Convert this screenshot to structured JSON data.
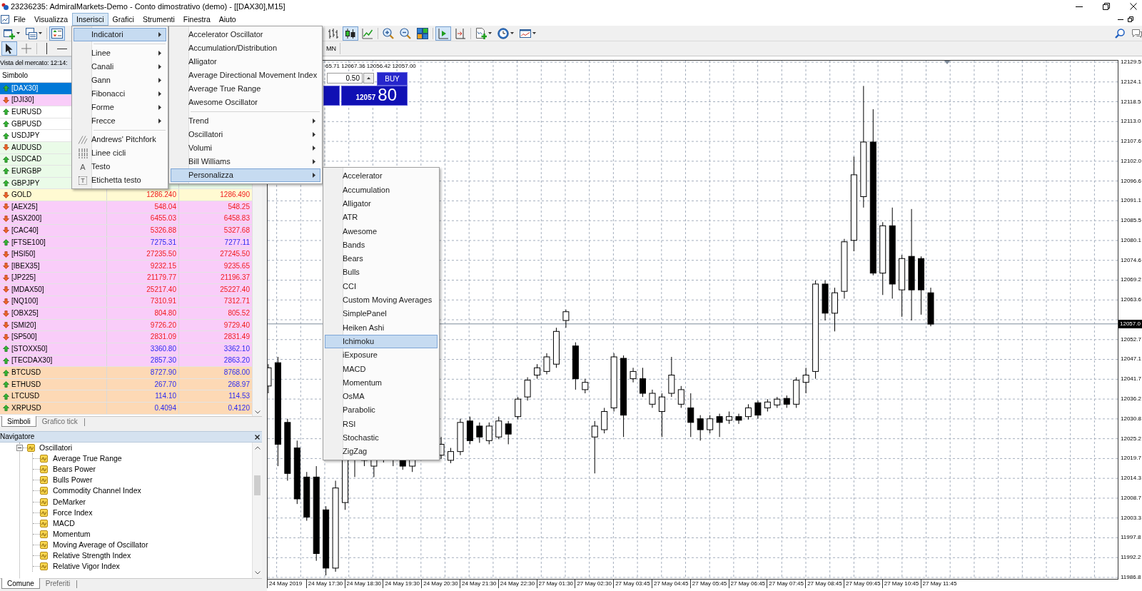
{
  "window": {
    "title": "23236235: AdmiralMarkets-Demo - Conto dimostrativo (demo) - [[DAX30],M15]"
  },
  "menu_bar": [
    {
      "label": "File",
      "selected": false
    },
    {
      "label": "Visualizza",
      "selected": false
    },
    {
      "label": "Inserisci",
      "selected": true
    },
    {
      "label": "Grafici",
      "selected": false
    },
    {
      "label": "Strumenti",
      "selected": false
    },
    {
      "label": "Finestra",
      "selected": false
    },
    {
      "label": "Aiuto",
      "selected": false
    }
  ],
  "toolbar_1": {
    "left_groups": [
      [
        {
          "kind": "new-chart",
          "pressed": false
        },
        {
          "kind": "profiles",
          "pressed": false
        }
      ],
      [
        {
          "kind": "market-watch",
          "pressed": true
        }
      ]
    ],
    "right_groups": [
      [
        {
          "kind": "bar-chart",
          "pressed": false
        },
        {
          "kind": "candlesticks",
          "pressed": true
        },
        {
          "kind": "line-chart",
          "pressed": false
        }
      ],
      [
        {
          "kind": "zoom-in",
          "pressed": false
        },
        {
          "kind": "zoom-out",
          "pressed": false
        },
        {
          "kind": "tile",
          "pressed": false
        }
      ],
      [
        {
          "kind": "auto-scroll",
          "pressed": true
        },
        {
          "kind": "chart-shift",
          "pressed": false
        }
      ],
      [
        {
          "kind": "indicators",
          "pressed": false
        },
        {
          "kind": "periods",
          "pressed": false
        },
        {
          "kind": "templates",
          "pressed": false
        }
      ]
    ]
  },
  "toolbar_2": {
    "left_groups": [
      [
        {
          "kind": "cursor",
          "pressed": true
        },
        {
          "kind": "crosshair",
          "pressed": false
        }
      ],
      [
        {
          "kind": "vertical-line",
          "pressed": false
        },
        {
          "kind": "horizontal-line",
          "pressed": false
        }
      ]
    ],
    "timeframes": [
      {
        "label": "MN",
        "selected": false
      }
    ]
  },
  "insert_menu": {
    "groups": [
      [
        {
          "label": "Indicatori",
          "submenu": true,
          "selected": true
        }
      ],
      [
        {
          "label": "Linee",
          "submenu": true,
          "selected": false
        },
        {
          "label": "Canali",
          "submenu": true,
          "selected": false
        },
        {
          "label": "Gann",
          "submenu": true,
          "selected": false
        },
        {
          "label": "Fibonacci",
          "submenu": true,
          "selected": false
        },
        {
          "label": "Forme",
          "submenu": true,
          "selected": false
        },
        {
          "label": "Frecce",
          "submenu": true,
          "selected": false
        }
      ],
      [
        {
          "label": "Andrews' Pitchfork",
          "kind": "pitchfork",
          "submenu": false,
          "selected": false
        },
        {
          "label": "Linee cicli",
          "kind": "cycle-lines",
          "submenu": false,
          "selected": false
        },
        {
          "label": "Testo",
          "kind": "glyph",
          "glyph": "A",
          "submenu": false,
          "selected": false
        },
        {
          "label": "Etichetta testo",
          "kind": "boxed-glyph",
          "glyph": "T",
          "submenu": false,
          "selected": false
        }
      ]
    ]
  },
  "indicators_menu": {
    "groups": [
      [
        {
          "label": "Accelerator Oscillator",
          "submenu": false,
          "selected": false
        },
        {
          "label": "Accumulation/Distribution",
          "submenu": false,
          "selected": false
        },
        {
          "label": "Alligator",
          "submenu": false,
          "selected": false
        },
        {
          "label": "Average Directional Movement Index",
          "submenu": false,
          "selected": false
        },
        {
          "label": "Average True Range",
          "submenu": false,
          "selected": false
        },
        {
          "label": "Awesome Oscillator",
          "submenu": false,
          "selected": false
        }
      ],
      [
        {
          "label": "Trend",
          "submenu": true,
          "selected": false
        },
        {
          "label": "Oscillatori",
          "submenu": true,
          "selected": false
        },
        {
          "label": "Volumi",
          "submenu": true,
          "selected": false
        },
        {
          "label": "Bill Williams",
          "submenu": true,
          "selected": false
        },
        {
          "label": "Personalizza",
          "submenu": true,
          "selected": true
        }
      ]
    ]
  },
  "custom_menu": {
    "groups": [
      [
        {
          "label": "Accelerator",
          "selected": false
        },
        {
          "label": "Accumulation",
          "selected": false
        },
        {
          "label": "Alligator",
          "selected": false
        },
        {
          "label": "ATR",
          "selected": false
        },
        {
          "label": "Awesome",
          "selected": false
        },
        {
          "label": "Bands",
          "selected": false
        },
        {
          "label": "Bears",
          "selected": false
        },
        {
          "label": "Bulls",
          "selected": false
        },
        {
          "label": "CCI",
          "selected": false
        },
        {
          "label": "Custom Moving Averages",
          "selected": false
        },
        {
          "label": "SimplePanel",
          "selected": false
        },
        {
          "label": "Heiken Ashi",
          "selected": false
        },
        {
          "label": "Ichimoku",
          "selected": true
        },
        {
          "label": "iExposure",
          "selected": false
        },
        {
          "label": "MACD",
          "selected": false
        },
        {
          "label": "Momentum",
          "selected": false
        },
        {
          "label": "OsMA",
          "selected": false
        },
        {
          "label": "Parabolic",
          "selected": false
        },
        {
          "label": "RSI",
          "selected": false
        },
        {
          "label": "Stochastic",
          "selected": false
        },
        {
          "label": "ZigZag",
          "selected": false
        }
      ]
    ]
  },
  "market_watch": {
    "title": "Vista del mercato: 12:14:",
    "column_header": "Simbolo",
    "rows": [
      {
        "symbol": "[DAX30]",
        "rising": true,
        "selected": true
      },
      {
        "symbol": "[DJI30]",
        "rising": false,
        "selected": false,
        "color": "#f9cdf9"
      },
      {
        "symbol": "EURUSD",
        "rising": true,
        "selected": false,
        "color": "#ffffff"
      },
      {
        "symbol": "GBPUSD",
        "rising": true,
        "selected": false,
        "color": "#ffffff"
      },
      {
        "symbol": "USDJPY",
        "rising": true,
        "selected": false,
        "color": "#ffffff"
      },
      {
        "symbol": "AUDUSD",
        "rising": false,
        "selected": false,
        "color": "#eafbe8"
      },
      {
        "symbol": "USDCAD",
        "rising": true,
        "selected": false,
        "color": "#eafbe8"
      },
      {
        "symbol": "EURGBP",
        "rising": true,
        "selected": false,
        "color": "#eafbe8"
      },
      {
        "symbol": "GBPJPY",
        "rising": true,
        "selected": false,
        "color": "#eafbe8"
      },
      {
        "symbol": "GOLD",
        "rising": false,
        "selected": false,
        "color": "#fffad2",
        "bid": "1286.240",
        "ask": "1286.490"
      },
      {
        "symbol": "[AEX25]",
        "rising": false,
        "selected": false,
        "color": "#f9cdf9",
        "bid": "548.04",
        "ask": "548.25"
      },
      {
        "symbol": "[ASX200]",
        "rising": false,
        "selected": false,
        "color": "#f9cdf9",
        "bid": "6455.03",
        "ask": "6458.83"
      },
      {
        "symbol": "[CAC40]",
        "rising": false,
        "selected": false,
        "color": "#f9cdf9",
        "bid": "5326.88",
        "ask": "5327.68"
      },
      {
        "symbol": "[FTSE100]",
        "rising": true,
        "selected": false,
        "color": "#f9cdf9",
        "bid": "7275.31",
        "ask": "7277.11"
      },
      {
        "symbol": "[HSI50]",
        "rising": false,
        "selected": false,
        "color": "#f9cdf9",
        "bid": "27235.50",
        "ask": "27245.50"
      },
      {
        "symbol": "[IBEX35]",
        "rising": false,
        "selected": false,
        "color": "#f9cdf9",
        "bid": "9232.15",
        "ask": "9235.65"
      },
      {
        "symbol": "[JP225]",
        "rising": false,
        "selected": false,
        "color": "#f9cdf9",
        "bid": "21179.77",
        "ask": "21196.37"
      },
      {
        "symbol": "[MDAX50]",
        "rising": false,
        "selected": false,
        "color": "#f9cdf9",
        "bid": "25217.40",
        "ask": "25227.40"
      },
      {
        "symbol": "[NQ100]",
        "rising": false,
        "selected": false,
        "color": "#f9cdf9",
        "bid": "7310.91",
        "ask": "7312.71"
      },
      {
        "symbol": "[OBX25]",
        "rising": false,
        "selected": false,
        "color": "#f9cdf9",
        "bid": "804.80",
        "ask": "805.52"
      },
      {
        "symbol": "[SMI20]",
        "rising": false,
        "selected": false,
        "color": "#f9cdf9",
        "bid": "9726.20",
        "ask": "9729.40"
      },
      {
        "symbol": "[SP500]",
        "rising": false,
        "selected": false,
        "color": "#f9cdf9",
        "bid": "2831.09",
        "ask": "2831.49"
      },
      {
        "symbol": "[STOXX50]",
        "rising": true,
        "selected": false,
        "color": "#f9cdf9",
        "bid": "3360.80",
        "ask": "3362.10"
      },
      {
        "symbol": "[TECDAX30]",
        "rising": true,
        "selected": false,
        "color": "#f9cdf9",
        "bid": "2857.30",
        "ask": "2863.20"
      },
      {
        "symbol": "BTCUSD",
        "rising": true,
        "selected": false,
        "color": "#fdd9b5",
        "bid": "8727.90",
        "ask": "8768.00"
      },
      {
        "symbol": "ETHUSD",
        "rising": true,
        "selected": false,
        "color": "#fdd9b5",
        "bid": "267.70",
        "ask": "268.97"
      },
      {
        "symbol": "LTCUSD",
        "rising": true,
        "selected": false,
        "color": "#fdd9b5",
        "bid": "114.10",
        "ask": "114.53"
      },
      {
        "symbol": "XRPUSD",
        "rising": true,
        "selected": false,
        "color": "#fdd9b5",
        "bid": "0.4094",
        "ask": "0.4120"
      }
    ],
    "tabs": [
      {
        "label": "Simboli",
        "selected": true
      },
      {
        "label": "Grafico tick",
        "selected": false
      }
    ]
  },
  "navigator": {
    "title": "Navigatore",
    "tree": [
      {
        "label": "Oscillatori",
        "expanded": true,
        "children": [
          {
            "label": "Average True Range"
          },
          {
            "label": "Bears Power"
          },
          {
            "label": "Bulls Power"
          },
          {
            "label": "Commodity Channel Index"
          },
          {
            "label": "DeMarker"
          },
          {
            "label": "Force Index"
          },
          {
            "label": "MACD"
          },
          {
            "label": "Momentum"
          },
          {
            "label": "Moving Average of Oscillator"
          },
          {
            "label": "Relative Strength Index"
          },
          {
            "label": "Relative Vigor Index"
          }
        ]
      }
    ],
    "tabs": [
      {
        "label": "Comune",
        "selected": true
      },
      {
        "label": "Preferiti",
        "selected": false
      }
    ]
  },
  "chart": {
    "ohlc_text": "65.71 12067.36 12056.42 12057.00",
    "one_click": {
      "volume": "0.50",
      "buy_label": "BUY",
      "buy_price": "12057",
      "buy_pips": "80"
    },
    "price_scale": {
      "labels_above": [
        "12129.5",
        "12124.1",
        "12118.5",
        "12113.0",
        "12107.6",
        "12102.0",
        "12096.6",
        "12091.1",
        "12085.5",
        "12080.1",
        "12074.6",
        "12069.2",
        "12063.6"
      ],
      "current": "12057.0",
      "labels_below": [
        "12052.7",
        "12047.1",
        "12041.7",
        "12036.2",
        "12030.8",
        "12025.2",
        "12019.7",
        "12014.3",
        "12008.7",
        "12003.3",
        "11997.8",
        "11992.2",
        "11986.8"
      ]
    },
    "time_scale": [
      "24 May 2019",
      "24 May 17:30",
      "24 May 18:30",
      "24 May 19:30",
      "24 May 20:30",
      "24 May 21:30",
      "24 May 22:30",
      "27 May 01:30",
      "27 May 02:30",
      "27 May 03:45",
      "27 May 04:45",
      "27 May 05:45",
      "27 May 06:45",
      "27 May 07:45",
      "27 May 08:45",
      "27 May 09:45",
      "27 May 10:45",
      "27 May 11:45"
    ]
  }
}
